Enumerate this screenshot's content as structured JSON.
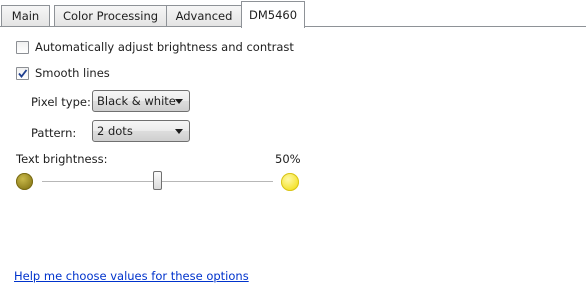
{
  "tabs": [
    {
      "label": "Main"
    },
    {
      "label": "Color Processing"
    },
    {
      "label": "Advanced"
    },
    {
      "label": "DM5460"
    }
  ],
  "active_tab": "DM5460",
  "options": {
    "auto_adjust": {
      "label": "Automatically adjust brightness and contrast",
      "checked": false
    },
    "smooth_lines": {
      "label": "Smooth lines",
      "checked": true
    }
  },
  "pixel_type": {
    "label": "Pixel type:",
    "value": "Black & white"
  },
  "pattern": {
    "label": "Pattern:",
    "value": "2 dots"
  },
  "text_brightness": {
    "label": "Text brightness:",
    "value_text": "50%",
    "value": 0.5
  },
  "icons": {
    "low": "dark-brightness-icon",
    "high": "light-brightness-icon",
    "check": "checkmark-icon"
  },
  "help_link": "Help me choose values for these options"
}
